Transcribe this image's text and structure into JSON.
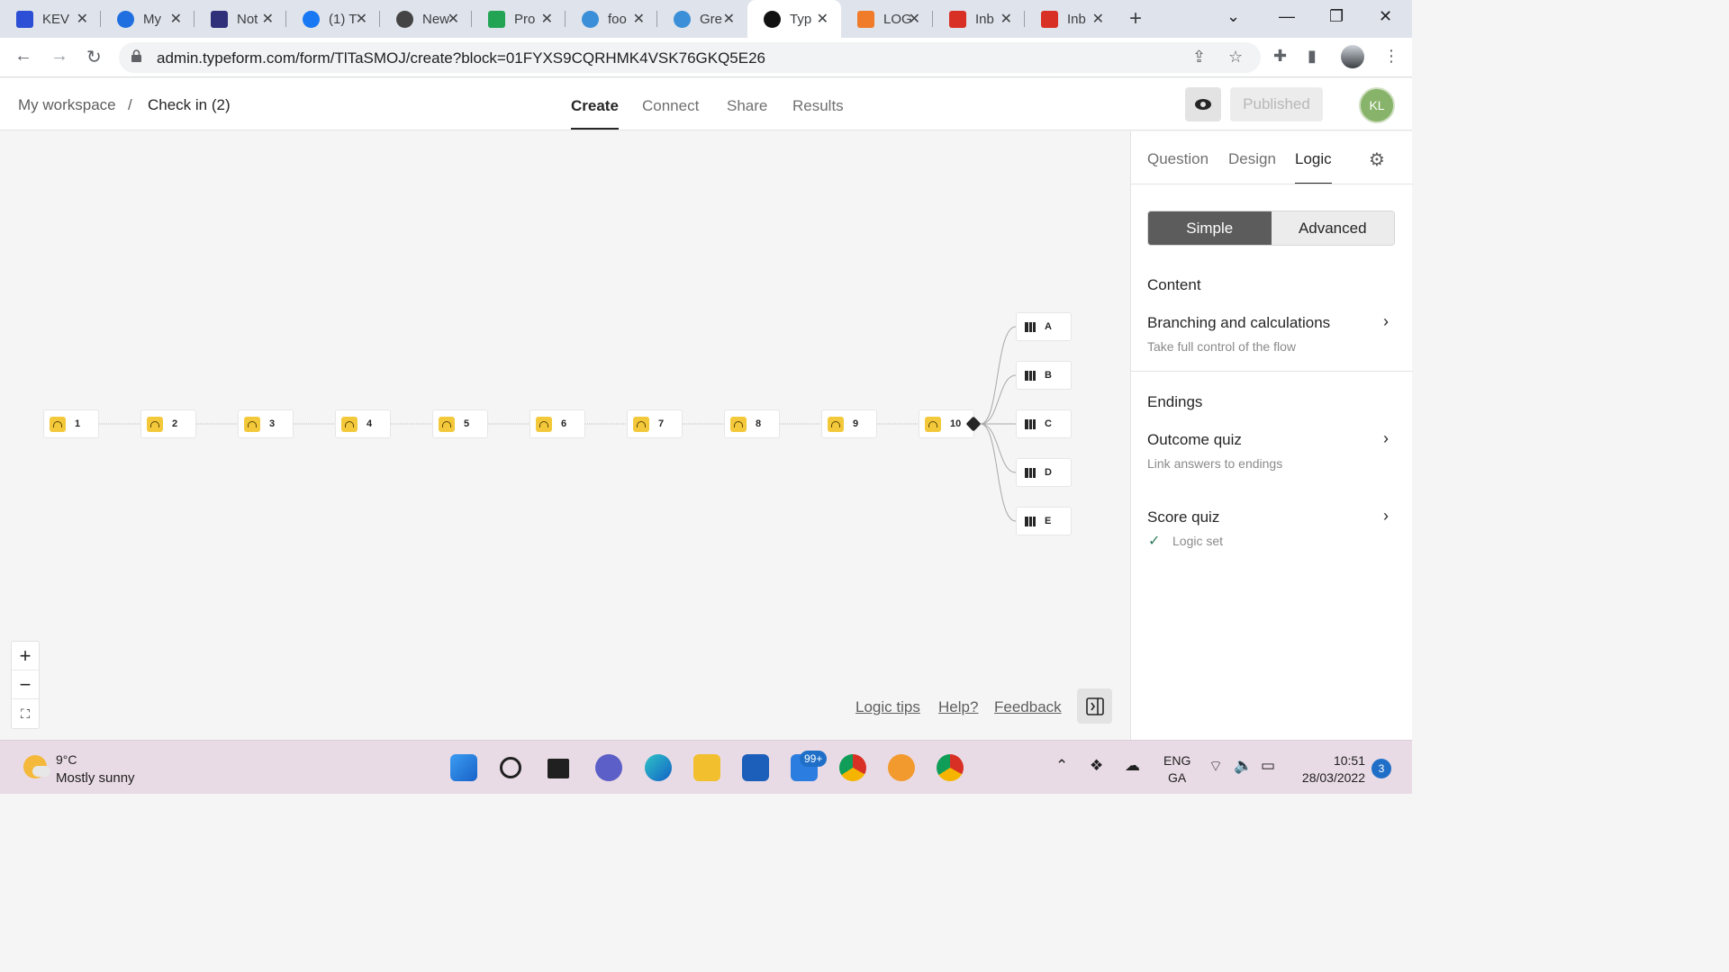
{
  "browser": {
    "tabs": [
      {
        "title": "KEV",
        "icon": "kev-icon",
        "color": "#2d4fd6"
      },
      {
        "title": "My",
        "icon": "c-logo-icon",
        "color": "#1f6fe0"
      },
      {
        "title": "Not",
        "icon": "e-logo-icon",
        "color": "#30307a"
      },
      {
        "title": "(1) T",
        "icon": "facebook-icon",
        "color": "#1877f2"
      },
      {
        "title": "New",
        "icon": "chrome-icon",
        "color": "#444444"
      },
      {
        "title": "Pro",
        "icon": "pd-icon",
        "color": "#23a455"
      },
      {
        "title": "foo",
        "icon": "canva-icon",
        "color": "#3a8fd8"
      },
      {
        "title": "Gre",
        "icon": "canva-icon",
        "color": "#3a8fd8"
      },
      {
        "title": "Typ",
        "icon": "typeform-icon",
        "color": "#111111",
        "active": true
      },
      {
        "title": "LOG",
        "icon": "hexagon-icon",
        "color": "#f07c2a"
      },
      {
        "title": "Inb",
        "icon": "gmail-icon",
        "color": "#d93025"
      },
      {
        "title": "Inb",
        "icon": "gmail-icon",
        "color": "#d93025"
      }
    ],
    "url": "admin.typeform.com/form/TlTaSMOJ/create?block=01FYXS9CQRHMK4VSK76GKQ5E26"
  },
  "header": {
    "breadcrumb": {
      "workspace": "My workspace",
      "separator": "/",
      "form": "Check in (2)"
    },
    "tabs": [
      "Create",
      "Connect",
      "Share",
      "Results"
    ],
    "active_tab": "Create",
    "published_label": "Published",
    "avatar_initials": "KL"
  },
  "canvas": {
    "questions": [
      "1",
      "2",
      "3",
      "4",
      "5",
      "6",
      "7",
      "8",
      "9",
      "10"
    ],
    "endings": [
      "A",
      "B",
      "C",
      "D",
      "E"
    ],
    "zoom": {
      "in": "+",
      "out": "−",
      "fit": "⛶"
    },
    "footer_links": [
      "Logic tips",
      "Help?",
      "Feedback"
    ]
  },
  "panel": {
    "tabs": [
      "Question",
      "Design",
      "Logic"
    ],
    "active_tab": "Logic",
    "mode": {
      "simple": "Simple",
      "advanced": "Advanced"
    },
    "content_title": "Content",
    "branching_title": "Branching and calculations",
    "branching_sub": "Take full control of the flow",
    "endings_title": "Endings",
    "outcome_title": "Outcome quiz",
    "outcome_sub": "Link answers to endings",
    "score_title": "Score quiz",
    "score_status": "Logic set"
  },
  "taskbar": {
    "temperature": "9°C",
    "weather": "Mostly sunny",
    "mail_badge": "99+",
    "lang_1": "ENG",
    "lang_2": "GA",
    "time": "10:51",
    "date": "28/03/2022",
    "notifications": "3"
  },
  "colors": {
    "question_icon": "#f3c93b",
    "avatar": "#87b36a",
    "accent": "#262627"
  }
}
